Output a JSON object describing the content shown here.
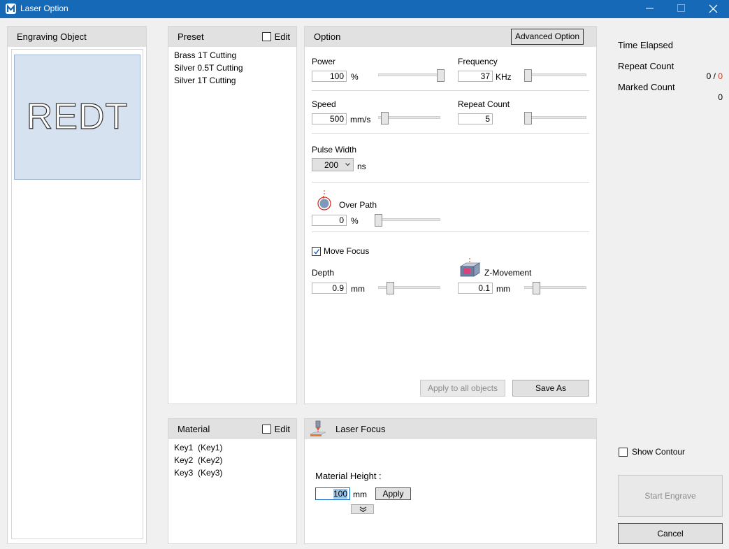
{
  "window": {
    "title": "Laser Option"
  },
  "engraving": {
    "title": "Engraving Object",
    "preview_text": "REDT"
  },
  "preset": {
    "title": "Preset",
    "edit_label": "Edit",
    "items": [
      "Brass 1T Cutting",
      "Silver 0.5T Cutting",
      "Silver 1T Cutting"
    ]
  },
  "option": {
    "title": "Option",
    "advanced_label": "Advanced Option",
    "power": {
      "label": "Power",
      "value": "100",
      "unit": "%",
      "level": 1.0
    },
    "frequency": {
      "label": "Frequency",
      "value": "37",
      "unit": "KHz",
      "level": 0.0
    },
    "speed": {
      "label": "Speed",
      "value": "500",
      "unit": "mm/s",
      "level": 0.05
    },
    "repeat_count": {
      "label": "Repeat Count",
      "value": "5",
      "level": 0.0
    },
    "pulse_width": {
      "label": "Pulse Width",
      "value": "200",
      "unit": "ns"
    },
    "over_path": {
      "label": "Over Path",
      "value": "0",
      "unit": "%",
      "level": 0.0
    },
    "move_focus": {
      "label": "Move Focus",
      "checked": true
    },
    "depth": {
      "label": "Depth",
      "value": "0.9",
      "unit": "mm",
      "level": 0.16
    },
    "z_movement": {
      "label": "Z-Movement",
      "value": "0.1",
      "unit": "mm",
      "level": 0.16
    },
    "apply_all_label": "Apply to all objects",
    "save_as_label": "Save As"
  },
  "material": {
    "title": "Material",
    "edit_label": "Edit",
    "items": [
      "Key1  (Key1)",
      "Key2  (Key2)",
      "Key3  (Key3)"
    ]
  },
  "laser_focus": {
    "title": "Laser Focus",
    "height_label": "Material Height :",
    "height_value": "100",
    "unit": "mm",
    "apply_label": "Apply"
  },
  "stats": {
    "time_elapsed_label": "Time Elapsed",
    "repeat_count_label": "Repeat Count",
    "repeat_done": "0",
    "repeat_sep": "/",
    "repeat_total": "0",
    "marked_count_label": "Marked Count",
    "marked_value": "0"
  },
  "controls": {
    "show_contour_label": "Show Contour",
    "start_label": "Start Engrave",
    "cancel_label": "Cancel"
  },
  "colors": {
    "titlebar": "#1569b7",
    "preview_bg": "#d6e2ef",
    "repeat_total_color": "#c0392b",
    "selection": "#99c4ea"
  }
}
